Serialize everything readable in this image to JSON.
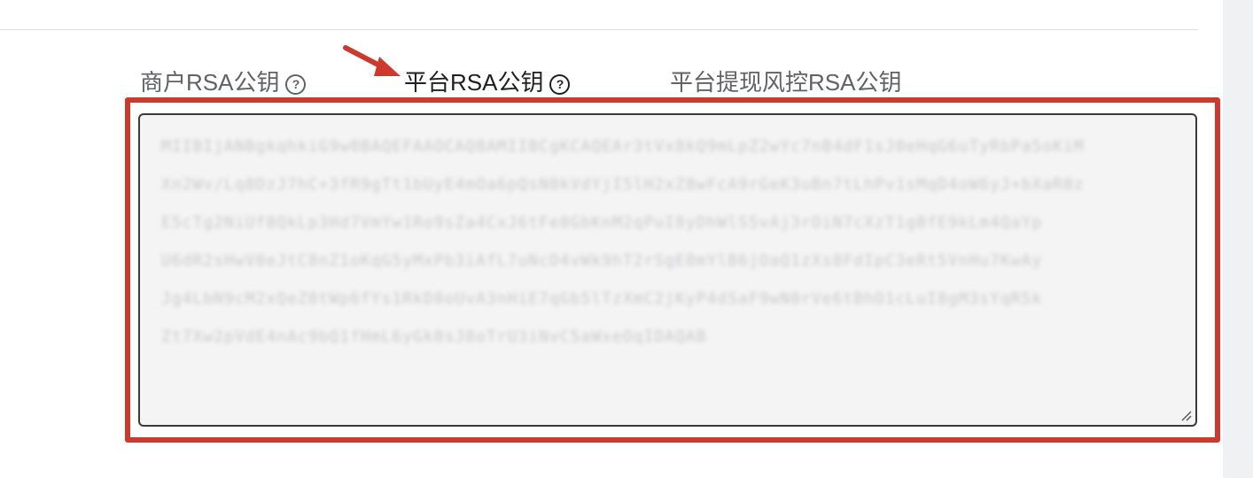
{
  "tabs": [
    {
      "label": "商户RSA公钥",
      "help": "?",
      "active": false
    },
    {
      "label": "平台RSA公钥",
      "help": "?",
      "active": true
    },
    {
      "label": "平台提现风控RSA公钥",
      "active": false
    }
  ],
  "textarea": {
    "value": "MIIBIjANBgkqhkiG9w0BAQEFAAOCAQ8AMIIBCgKCAQEAr3tVx8kQ9mLpZ2wYc7nB4dF1sJ0eHqG6uTyRbPa5oKiM\nXn2Wv/Lq8DzJ7hC+3fR9gTt1bUyE4mOa6pQsN0kVdYjI5lH2xZ8wFcA9rGeK3uBn7tLhPv1sMqD4oW6yJ+bXaR0z\nE5cTg2NiUf8QkLp3Hd7VmYw1Ro9sZa4CxJ6tFe0GbKnM2qPuI8yDhWlS5vAj3rOiN7cXzT1gBfE9kLm4QaYp\nU6dR2sHwV0eJtC8nZ1oKqG5yMxPb3iAfL7uNcD4vWk9hT2rSgE0mYlB6jOaQ1zXs8FdIpC3eRt5VnHu7KwAy\nJg4LbN9cM2xQeZ0tWp6fYs1RkD8oUvA3nHiE7qGb5lTzXmC2jKyP4dSaF9wN0rVe6tBhO1cLuI8gM3sYqR5k\nZt7Xw2pVdE4nAc9bQ1fHmL6yGk0sJ8oTrU3iNvC5aWxeOqIDAQAB"
  }
}
